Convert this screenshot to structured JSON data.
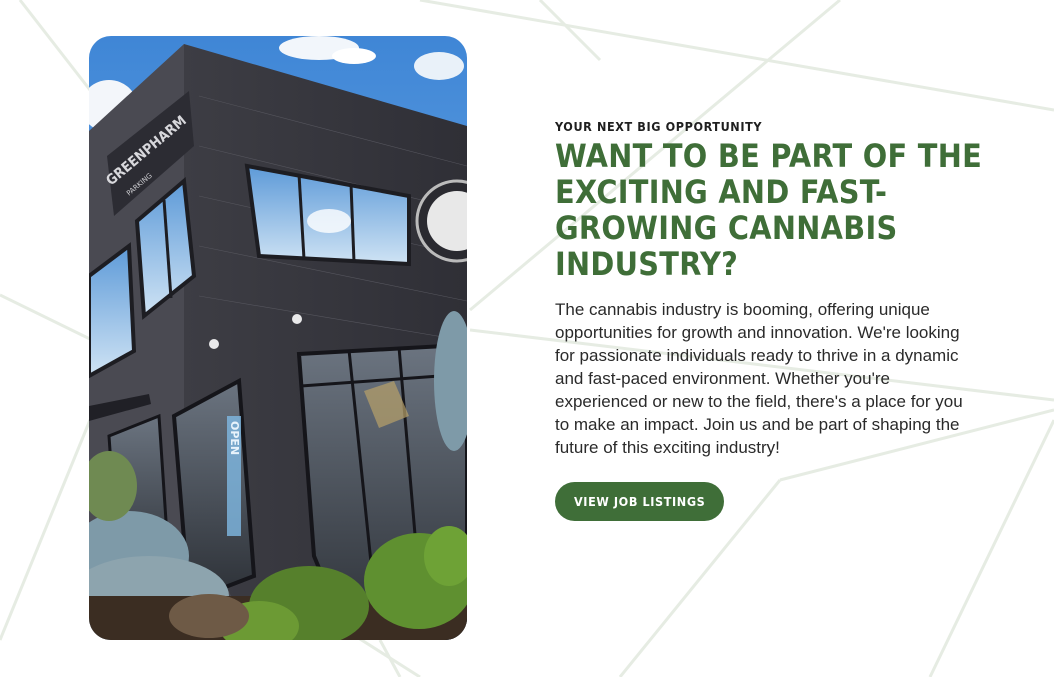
{
  "section": {
    "eyebrow": "YOUR NEXT BIG OPPORTUNITY",
    "heading": "WANT TO BE PART OF THE EXCITING AND FAST-GROWING CANNABIS INDUSTRY?",
    "body": "The cannabis industry is booming, offering unique opportunities for growth and innovation. We're looking for passionate individuals ready to thrive in a dynamic and fast-paced environment. Whether you're experienced or new to the field, there's a place for you to make an impact. Join us and be part of shaping the future of this exciting industry!",
    "cta_label": "VIEW JOB LISTINGS"
  },
  "photo": {
    "sign_text": "GREENPHARM",
    "sign_subtext": "PARKING",
    "door_text": "OPEN"
  },
  "colors": {
    "brand_green": "#3f6e38",
    "line_color": "#e6ece3",
    "text_dark": "#2a2a2a"
  }
}
